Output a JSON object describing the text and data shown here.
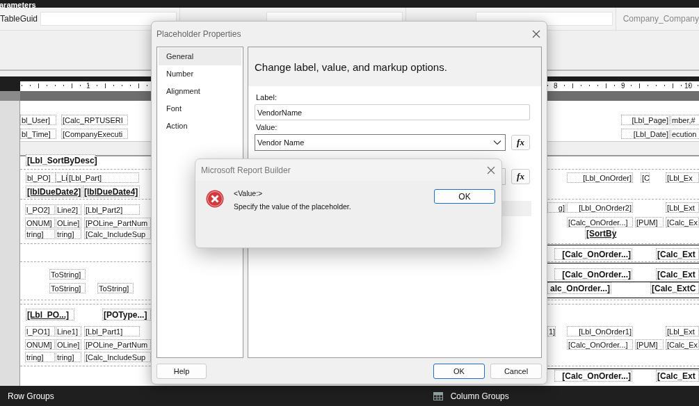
{
  "app": {
    "title_fragment": "arameters"
  },
  "parameter_bar": {
    "label_1": "TableGuid",
    "label_2": "Company_Company"
  },
  "ruler": {
    "marks": [
      "1",
      "8",
      "9",
      "10"
    ]
  },
  "report_items": [
    {
      "text": "bl_User]",
      "kind": "plain"
    },
    {
      "text": "[Calc_RPTUSERI",
      "kind": "plain"
    },
    {
      "text": "bl_Time]",
      "kind": "plain"
    },
    {
      "text": "[CompanyExecuti",
      "kind": "plain"
    },
    {
      "text": "[Lbl_Page]",
      "kind": "plain"
    },
    {
      "text": "mber,#",
      "kind": "plain"
    },
    {
      "text": "[Lbl_Date]",
      "kind": "plain"
    },
    {
      "text": "ecution",
      "kind": "plain"
    },
    {
      "text": "[Lbl_SortByDesc]",
      "kind": "bold"
    },
    {
      "text": "bl_PO]",
      "kind": "plain"
    },
    {
      "text": "_Li",
      "kind": "plain"
    },
    {
      "text": "[Lbl_Part]",
      "kind": "plain"
    },
    {
      "text": "[Lbl_OnOrder]",
      "kind": "plain"
    },
    {
      "text": "[C",
      "kind": "plain"
    },
    {
      "text": "[Lbl_Ex",
      "kind": "plain"
    },
    {
      "text": "[lblDueDate2]",
      "kind": "underlined"
    },
    {
      "text": "[lblDueDate4]",
      "kind": "underlined"
    },
    {
      "text": "l_PO2]",
      "kind": "plain"
    },
    {
      "text": "Line2]",
      "kind": "plain"
    },
    {
      "text": "[Lbl_Part2]",
      "kind": "plain"
    },
    {
      "text": "g]",
      "kind": "plain"
    },
    {
      "text": "[Lbl_OnOrder2]",
      "kind": "plain"
    },
    {
      "text": "[Lbl_Ext",
      "kind": "plain"
    },
    {
      "text": "ONUM]",
      "kind": "plain"
    },
    {
      "text": "OLine]",
      "kind": "plain"
    },
    {
      "text": "[POLine_PartNum",
      "kind": "plain"
    },
    {
      "text": "[Calc_OnOrder...]",
      "kind": "plain"
    },
    {
      "text": "[PUM]",
      "kind": "plain"
    },
    {
      "text": "[Calc_Ex",
      "kind": "plain"
    },
    {
      "text": "tring]",
      "kind": "plain"
    },
    {
      "text": "tring]",
      "kind": "plain"
    },
    {
      "text": "[Calc_IncludeSup",
      "kind": "plain"
    },
    {
      "text": "[SortBy",
      "kind": "underlined"
    },
    {
      "text": "[Calc_OnOrder...]",
      "kind": "bold"
    },
    {
      "text": "[Calc_Ext",
      "kind": "bold"
    },
    {
      "text": "ToString]",
      "kind": "plain"
    },
    {
      "text": "[Calc_OnOrder...]",
      "kind": "bold"
    },
    {
      "text": "[Calc_Ext",
      "kind": "bold"
    },
    {
      "text": "ToString]",
      "kind": "plain"
    },
    {
      "text": "ToString]",
      "kind": "plain"
    },
    {
      "text": "alc_OnOrder...]",
      "kind": "bold"
    },
    {
      "text": "[Calc_ExtC",
      "kind": "bold"
    },
    {
      "text": "[Lbl_PO...]",
      "kind": "underlined"
    },
    {
      "text": "[POType...]",
      "kind": "bold"
    },
    {
      "text": "l_PO1]",
      "kind": "plain"
    },
    {
      "text": "Line1]",
      "kind": "plain"
    },
    {
      "text": "[Lbl_Part1]",
      "kind": "plain"
    },
    {
      "text": "1]",
      "kind": "plain"
    },
    {
      "text": "[Lbl_OnOrder1]",
      "kind": "plain"
    },
    {
      "text": "[Lbl_Ext",
      "kind": "plain"
    },
    {
      "text": "ONUM]",
      "kind": "plain"
    },
    {
      "text": "OLine]",
      "kind": "plain"
    },
    {
      "text": "[POLine_PartNum",
      "kind": "plain"
    },
    {
      "text": "[Calc_OnOrder...]",
      "kind": "plain"
    },
    {
      "text": "[PUM]",
      "kind": "plain"
    },
    {
      "text": "[Calc_Ex",
      "kind": "plain"
    },
    {
      "text": "tring]",
      "kind": "plain"
    },
    {
      "text": "tring]",
      "kind": "plain"
    },
    {
      "text": "[Calc_IncludeSup",
      "kind": "plain"
    },
    {
      "text": "[Calc_OnOrder...]",
      "kind": "bold"
    },
    {
      "text": "[Calc_Ext",
      "kind": "bold"
    }
  ],
  "bottom_bar": {
    "row_groups": "Row Groups",
    "column_groups": "Column Groups"
  },
  "dialog": {
    "title": "Placeholder Properties",
    "nav": [
      {
        "label": "General",
        "selected": true
      },
      {
        "label": "Number",
        "selected": false
      },
      {
        "label": "Alignment",
        "selected": false
      },
      {
        "label": "Font",
        "selected": false
      },
      {
        "label": "Action",
        "selected": false
      }
    ],
    "heading": "Change label, value, and markup options.",
    "label_caption": "Label:",
    "label_value": "VendorName",
    "value_caption": "Value:",
    "value_value": "Vendor Name",
    "fx_buttons": [
      "fx",
      "fx"
    ],
    "buttons": [
      {
        "label": "Help",
        "kind": "normal"
      },
      {
        "label": "OK",
        "kind": "primary"
      },
      {
        "label": "Cancel",
        "kind": "normal"
      }
    ]
  },
  "message_box": {
    "title": "Microsoft Report Builder",
    "heading": "<Value:>",
    "message": "Specify the value of the placeholder.",
    "button": "OK"
  }
}
